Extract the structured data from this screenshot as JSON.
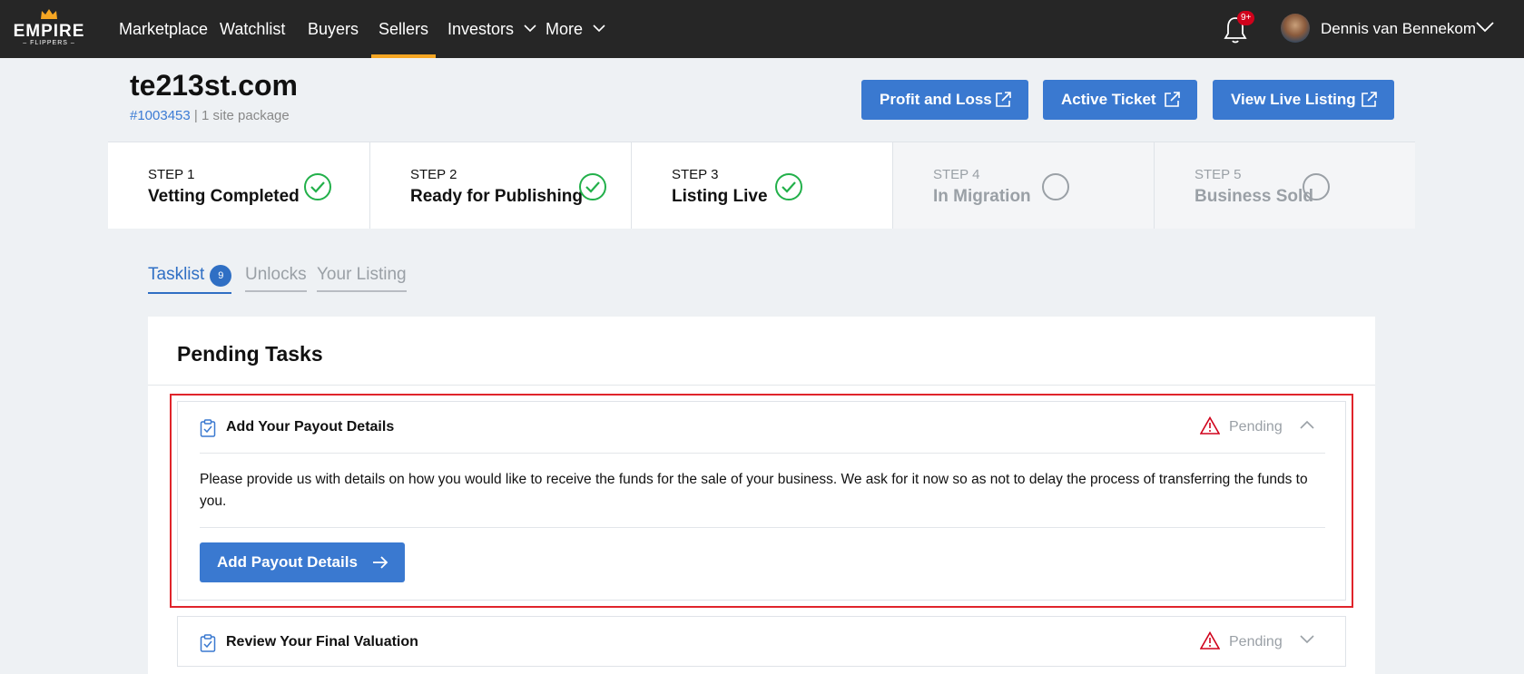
{
  "brand": {
    "wordmark": "EMPIRE",
    "subtext": "– FLIPPERS –",
    "crown_color": "#f5a623"
  },
  "nav": {
    "items": [
      {
        "label": "Marketplace"
      },
      {
        "label": "Watchlist"
      },
      {
        "label": "Buyers"
      },
      {
        "label": "Sellers",
        "active": true
      },
      {
        "label": "Investors",
        "dropdown": true
      },
      {
        "label": "More",
        "dropdown": true
      }
    ],
    "notifications_badge": "9+",
    "user_name": "Dennis van Bennekom"
  },
  "header": {
    "site_title": "te213st.com",
    "listing_id": "#1003453",
    "separator": " | ",
    "package": "1 site package",
    "buttons": [
      {
        "label": "Profit and Loss",
        "icon": "external-link-icon"
      },
      {
        "label": "Active Ticket",
        "icon": "external-link-icon"
      },
      {
        "label": "View Live Listing",
        "icon": "external-link-icon"
      }
    ]
  },
  "steps": [
    {
      "label": "STEP 1",
      "name": "Vetting Completed",
      "done": true
    },
    {
      "label": "STEP 2",
      "name": "Ready for Publishing",
      "done": true
    },
    {
      "label": "STEP 3",
      "name": "Listing Live",
      "done": true
    },
    {
      "label": "STEP 4",
      "name": "In Migration",
      "done": false
    },
    {
      "label": "STEP 5",
      "name": "Business Sold",
      "done": false
    }
  ],
  "tabs": [
    {
      "label": "Tasklist",
      "count": "9",
      "active": true
    },
    {
      "label": "Unlocks"
    },
    {
      "label": "Your Listing"
    }
  ],
  "panel": {
    "title": "Pending Tasks",
    "tasks": [
      {
        "title": "Add Your Payout Details",
        "status": "Pending",
        "expanded": true,
        "description": "Please provide us with details on how you would like to receive the funds for the sale of your business. We ask for it now so as not to delay the process of transferring the funds to you.",
        "cta": "Add Payout Details"
      },
      {
        "title": "Review Your Final Valuation",
        "status": "Pending",
        "expanded": false
      }
    ]
  },
  "colors": {
    "primary": "#3a79d0",
    "success": "#22b04a",
    "warning": "#d0021b",
    "nav_bg": "#262626",
    "active_underline": "#f5a623"
  }
}
